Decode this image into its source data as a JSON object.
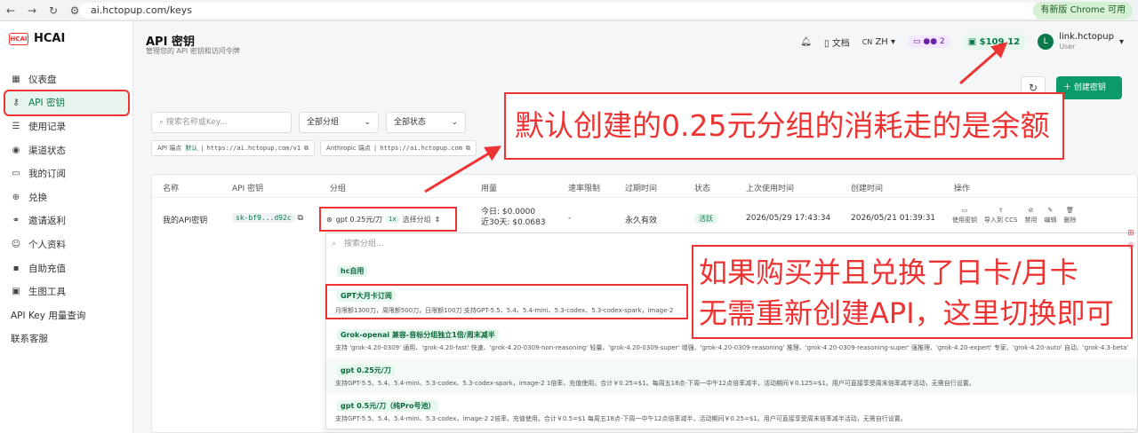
{
  "browser": {
    "back": "←",
    "forward": "→",
    "reload": "↻",
    "tune": "⚙",
    "url": "ai.hctopup.com/keys",
    "update": "有新版 Chrome 可用"
  },
  "sidebar": {
    "logo_mark": "HCAI",
    "logo_text": "HCAI",
    "items": [
      {
        "icon": "▦",
        "label": "仪表盘"
      },
      {
        "icon": "⚷",
        "label": "API 密钥"
      },
      {
        "icon": "☰",
        "label": "使用记录"
      },
      {
        "icon": "◉",
        "label": "渠道状态"
      },
      {
        "icon": "▭",
        "label": "我的订阅"
      },
      {
        "icon": "⊕",
        "label": "兑换"
      },
      {
        "icon": "⚭",
        "label": "邀请返利"
      },
      {
        "icon": "☺",
        "label": "个人资料"
      },
      {
        "icon": "▪",
        "label": "自助充值"
      },
      {
        "icon": "▣",
        "label": "生图工具"
      },
      {
        "icon": "",
        "label": "API Key 用量查询"
      },
      {
        "icon": "",
        "label": "联系客服"
      }
    ]
  },
  "header": {
    "title": "API 密钥",
    "subtitle": "管理您的 API 密钥和访问令牌",
    "docs": "文档",
    "lang": "ZH",
    "lang_prefix": "CN",
    "badge_count": "2",
    "balance": "$109.12",
    "avatar": "L",
    "user_name": "link.hctopup",
    "user_role": "User"
  },
  "actions": {
    "create": "创建密钥"
  },
  "filters": {
    "search_placeholder": "搜索名称或Key...",
    "group": "全部分组",
    "status": "全部状态"
  },
  "endpoints": [
    {
      "label": "API 端点",
      "tag": "默认",
      "url": "https://ai.hctopup.com/v1"
    },
    {
      "label": "Anthropic 端点",
      "tag": "",
      "url": "https://ai.hctopup.com"
    }
  ],
  "table": {
    "columns": [
      "名称",
      "API 密钥",
      "分组",
      "用量",
      "速率限制",
      "过期时间",
      "状态",
      "上次使用时间",
      "创建时间",
      "操作"
    ],
    "row": {
      "name": "我的API密钥",
      "key": "sk-bf9...d92c",
      "group": "gpt 0.25元/刀",
      "group_mult": "1x",
      "group_select": "选择分组",
      "usage_today": "今日: $0.0000",
      "usage_30": "近30天: $0.0683",
      "rate": "-",
      "expire": "永久有效",
      "status": "活跃",
      "last_used": "2026/05/29 17:43:34",
      "created": "2026/05/21 01:39:31"
    },
    "row_actions": [
      "使用密钥",
      "导入到 CCS",
      "禁用",
      "编辑",
      "删除"
    ]
  },
  "dropdown": {
    "search_placeholder": "搜索分组...",
    "items": [
      {
        "title": "hc自用",
        "desc": ""
      },
      {
        "title": "GPT大月卡订阅",
        "desc": "月限额1300刀，周限额500刀，日限额100刀 支持GPT-5.5、5.4、5.4-mini、5.3-codex、5.3-codex-spark，image-2"
      },
      {
        "title": "Grok-openai 兼容-音标分组独立1倍/周末减半",
        "desc": "支持 'grok-4.20-0309' 通用、'grok-4.20-fast' 快速、'grok-4.20-0309-non-reasoning' 轻量、'grok-4.20-0309-super' 增强、'grok-4.20-0309-reasoning' 推理、'grok-4.20-0309-reasoning-super' 强推理、'grok-4.20-expert' 专家、'grok-4.20-auto' 自动、'grok-4.3-beta'"
      },
      {
        "title": "gpt 0.25元/刀",
        "desc": "支持GPT-5.5、5.4、5.4-mini、5.3-codex、5.3-codex-spark，image-2 1倍率，充值使用。合计￥0.25=$1。每周五18点-下周一中午12点倍率减半，活动期间￥0.125=$1。用户可直接享受周末倍率减半活动，无需自行设置。"
      },
      {
        "title": "gpt 0.5元/刀（纯Pro号池）",
        "desc": "支持GPT-5.5、5.4、5.4-mini、5.3-codex，image-2 2倍率，充值使用。合计￥0.5=$1 每周五18点-下周一中午12点倍率减半，活动期间￥0.25=$1。用户可直接享受周末倍率减半活动，无需自行设置。"
      }
    ]
  },
  "annotations": {
    "callout1": "默认创建的0.25元分组的消耗走的是余额",
    "callout2_line1": "如果购买并且兑换了日卡/月卡",
    "callout2_line2": "无需重新创建API，这里切换即可"
  },
  "colors": {
    "accent": "#0b9b6a",
    "annotation": "#e33333"
  }
}
